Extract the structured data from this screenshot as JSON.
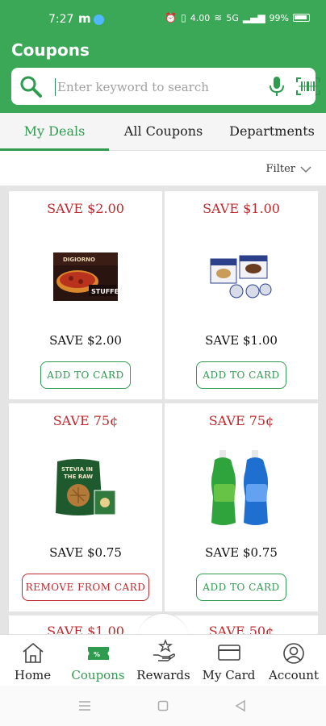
{
  "status_bar": {
    "time": "7:27",
    "m_icon": "m",
    "data_speed": "4.00",
    "network": "5G",
    "battery": "99%"
  },
  "header": {
    "title": "Coupons",
    "search_placeholder": "Enter keyword to search"
  },
  "tabs": [
    {
      "label": "My Deals",
      "active": true
    },
    {
      "label": "All Coupons",
      "active": false
    },
    {
      "label": "Departments",
      "active": false
    }
  ],
  "filter": {
    "label": "Filter"
  },
  "cards": [
    {
      "save": "SAVE $2.00",
      "description": "SAVE $2.00",
      "button": "ADD TO CARD",
      "image": "stuffed-pizza-box"
    },
    {
      "save": "SAVE $1.00",
      "description": "SAVE $1.00",
      "button": "ADD TO CARD",
      "image": "dessert-cups"
    },
    {
      "save": "SAVE 75¢",
      "description": "SAVE $0.75",
      "button": "REMOVE FROM CARD",
      "image": "frozen-waffles-bag"
    },
    {
      "save": "SAVE 75¢",
      "description": "SAVE $0.75",
      "button": "ADD TO CARD",
      "image": "dish-soap-bottles"
    },
    {
      "save": "SAVE $1.00",
      "description": "",
      "button": "",
      "image": ""
    },
    {
      "save": "SAVE 50¢",
      "description": "",
      "button": "",
      "image": ""
    }
  ],
  "bottom_nav": [
    {
      "label": "Home",
      "icon": "house-icon",
      "active": false
    },
    {
      "label": "Coupons",
      "icon": "coupon-ticket-icon",
      "active": true
    },
    {
      "label": "Rewards",
      "icon": "rewards-hand-star-icon",
      "active": false
    },
    {
      "label": "My Card",
      "icon": "card-icon",
      "active": false
    },
    {
      "label": "Account",
      "icon": "account-icon",
      "active": false
    }
  ],
  "colors": {
    "brand_green": "#3aa857",
    "accent_green": "#2e9b4f",
    "save_red": "#c0282d"
  }
}
